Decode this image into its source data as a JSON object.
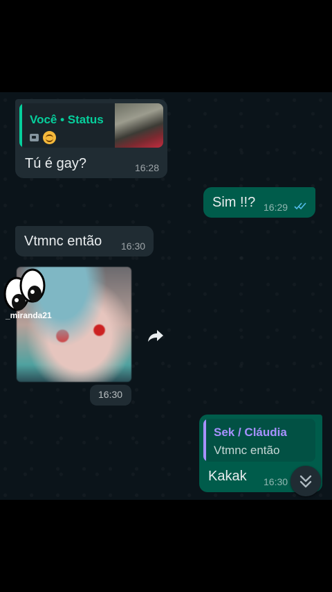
{
  "messages": {
    "m1": {
      "quote_title": "Você • Status",
      "text": "Tú é gay?",
      "time": "16:28"
    },
    "m2": {
      "text": "Sim !!?",
      "time": "16:29",
      "status_icon": "double-check-read-icon",
      "status_color": "#53bdeb"
    },
    "m3": {
      "text": "Vtmnc então",
      "time": "16:30"
    },
    "image_message": {
      "sticker_caption": "_miranda21",
      "time": "16:30"
    },
    "m4": {
      "quote_title": "Sek / Cláudia",
      "quote_text": "Vtmnc então",
      "text": "Kakak",
      "time": "16:30"
    }
  },
  "colors": {
    "chat_background": "#0b141a",
    "incoming_bubble": "#202c33",
    "outgoing_bubble": "#005c4b",
    "status_quote_accent": "#06cf9c",
    "reply_quote_accent": "#a791ff"
  },
  "icons": {
    "forward": "forward-arrow-icon",
    "scroll": "chevron-double-down-icon",
    "photo": "photo-icon",
    "emoji": "upside-down-smile-icon"
  }
}
